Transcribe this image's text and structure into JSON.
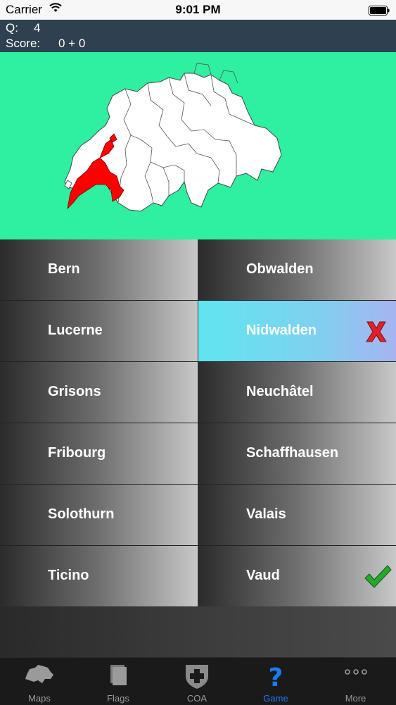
{
  "status_bar": {
    "carrier": "Carrier",
    "time": "9:01 PM"
  },
  "quiz": {
    "question_label": "Q:",
    "question_number": "4",
    "score_label": "Score:",
    "score_value": "0 + 0"
  },
  "map": {
    "background_color": "#2ef0a0",
    "highlight_color": "#ff0000"
  },
  "answers": {
    "left": [
      "Bern",
      "Lucerne",
      "Grisons",
      "Fribourg",
      "Solothurn",
      "Ticino"
    ],
    "right": [
      "Obwalden",
      "Nidwalden",
      "Neuchâtel",
      "Schaffhausen",
      "Valais",
      "Vaud"
    ],
    "wrong_answer": "Nidwalden",
    "correct_answer": "Vaud"
  },
  "tabs": [
    {
      "label": "Maps",
      "icon": "switzerland-map-icon"
    },
    {
      "label": "Flags",
      "icon": "flags-icon"
    },
    {
      "label": "COA",
      "icon": "coat-of-arms-icon"
    },
    {
      "label": "Game",
      "icon": "question-mark-icon",
      "active": true
    },
    {
      "label": "More",
      "icon": "more-dots-icon"
    }
  ]
}
